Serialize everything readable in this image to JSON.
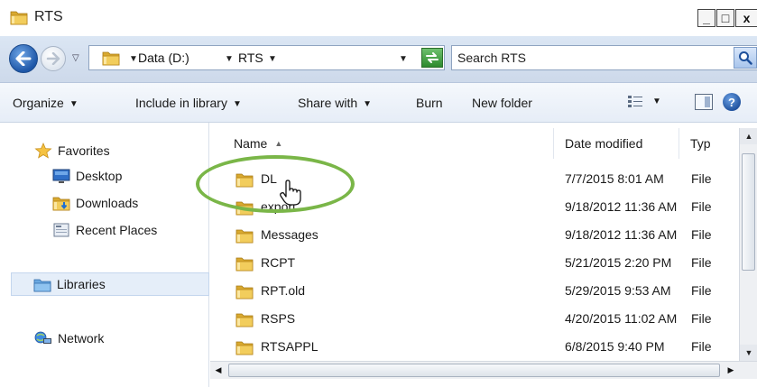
{
  "window": {
    "title": "RTS",
    "minimize_label": "_",
    "maximize_label": "□",
    "close_label": "x"
  },
  "address_bar": {
    "breadcrumbs": [
      "Data (D:)",
      "RTS"
    ],
    "search_placeholder": "Search RTS"
  },
  "toolbar": {
    "organize": "Organize",
    "include_in_library": "Include in library",
    "share_with": "Share with",
    "burn": "Burn",
    "new_folder": "New folder",
    "help": "?"
  },
  "nav_pane": {
    "favorites": "Favorites",
    "desktop": "Desktop",
    "downloads": "Downloads",
    "recent_places": "Recent Places",
    "libraries": "Libraries",
    "network": "Network"
  },
  "columns": {
    "name": "Name",
    "date_modified": "Date modified",
    "type": "Typ"
  },
  "files": [
    {
      "name": "DL",
      "date": "7/7/2015 8:01 AM",
      "type": "File"
    },
    {
      "name": "export",
      "date": "9/18/2012 11:36 AM",
      "type": "File"
    },
    {
      "name": "Messages",
      "date": "9/18/2012 11:36 AM",
      "type": "File"
    },
    {
      "name": "RCPT",
      "date": "5/21/2015 2:20 PM",
      "type": "File"
    },
    {
      "name": "RPT.old",
      "date": "5/29/2015 9:53 AM",
      "type": "File"
    },
    {
      "name": "RSPS",
      "date": "4/20/2015 11:02 AM",
      "type": "File"
    },
    {
      "name": "RTSAPPL",
      "date": "6/8/2015 9:40 PM",
      "type": "File"
    }
  ],
  "colors": {
    "highlight_ring": "#7ab648",
    "folder_yellow": "#e8c04a"
  }
}
